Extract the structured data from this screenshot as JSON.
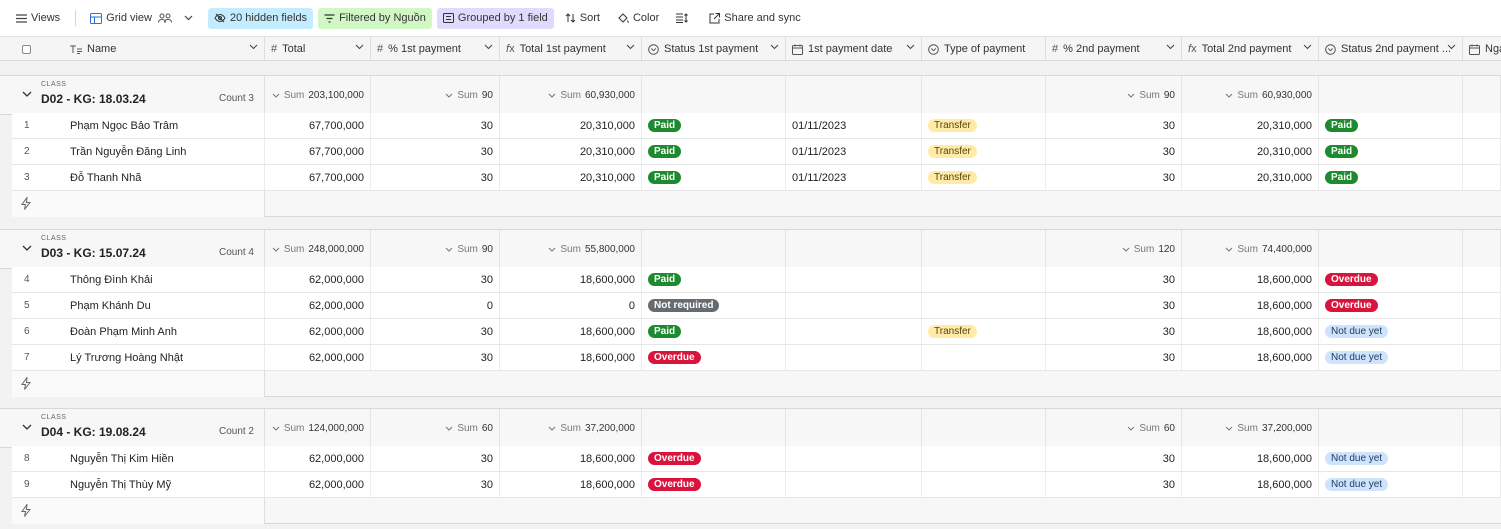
{
  "toolbar": {
    "views": "Views",
    "grid_view": "Grid view",
    "hidden_fields": "20 hidden fields",
    "filtered": "Filtered by Nguồn",
    "grouped": "Grouped by 1 field",
    "sort": "Sort",
    "color": "Color",
    "share": "Share and sync"
  },
  "columns": {
    "name": "Name",
    "total": "Total",
    "pct1": "% 1st payment",
    "total1": "Total 1st payment",
    "status1": "Status 1st payment",
    "date1": "1st payment date",
    "type": "Type of payment",
    "pct2": "% 2nd payment",
    "total2": "Total 2nd payment",
    "status2": "Status 2nd payment ...",
    "next": "Nga"
  },
  "sum_label": "Sum",
  "group_field_label": "CLASS",
  "groups": [
    {
      "title": "D02 - KG: 18.03.24",
      "count": "Count 3",
      "sums": {
        "total": "203,100,000",
        "pct1": "90",
        "total1": "60,930,000",
        "pct2": "90",
        "total2": "60,930,000"
      },
      "rows": [
        {
          "n": "1",
          "name": "Phạm Ngọc Bảo Trâm",
          "total": "67,700,000",
          "pct1": "30",
          "total1": "20,310,000",
          "status1": "Paid",
          "date1": "01/11/2023",
          "type": "Transfer",
          "pct2": "30",
          "total2": "20,310,000",
          "status2": "Paid"
        },
        {
          "n": "2",
          "name": "Trần Nguyễn Đăng Linh",
          "total": "67,700,000",
          "pct1": "30",
          "total1": "20,310,000",
          "status1": "Paid",
          "date1": "01/11/2023",
          "type": "Transfer",
          "pct2": "30",
          "total2": "20,310,000",
          "status2": "Paid"
        },
        {
          "n": "3",
          "name": "Đỗ Thanh Nhã",
          "total": "67,700,000",
          "pct1": "30",
          "total1": "20,310,000",
          "status1": "Paid",
          "date1": "01/11/2023",
          "type": "Transfer",
          "pct2": "30",
          "total2": "20,310,000",
          "status2": "Paid"
        }
      ]
    },
    {
      "title": "D03 - KG: 15.07.24",
      "count": "Count 4",
      "sums": {
        "total": "248,000,000",
        "pct1": "90",
        "total1": "55,800,000",
        "pct2": "120",
        "total2": "74,400,000"
      },
      "rows": [
        {
          "n": "4",
          "name": "Thông Đình Khải",
          "total": "62,000,000",
          "pct1": "30",
          "total1": "18,600,000",
          "status1": "Paid",
          "date1": "",
          "type": "",
          "pct2": "30",
          "total2": "18,600,000",
          "status2": "Overdue"
        },
        {
          "n": "5",
          "name": "Phạm Khánh Du",
          "total": "62,000,000",
          "pct1": "0",
          "total1": "0",
          "status1": "Not required",
          "date1": "",
          "type": "",
          "pct2": "30",
          "total2": "18,600,000",
          "status2": "Overdue"
        },
        {
          "n": "6",
          "name": "Đoàn Phạm Minh Anh",
          "total": "62,000,000",
          "pct1": "30",
          "total1": "18,600,000",
          "status1": "Paid",
          "date1": "",
          "type": "Transfer",
          "pct2": "30",
          "total2": "18,600,000",
          "status2": "Not due yet"
        },
        {
          "n": "7",
          "name": "Lý Trương Hoàng Nhật",
          "total": "62,000,000",
          "pct1": "30",
          "total1": "18,600,000",
          "status1": "Overdue",
          "date1": "",
          "type": "",
          "pct2": "30",
          "total2": "18,600,000",
          "status2": "Not due yet"
        }
      ]
    },
    {
      "title": "D04 - KG: 19.08.24",
      "count": "Count 2",
      "sums": {
        "total": "124,000,000",
        "pct1": "60",
        "total1": "37,200,000",
        "pct2": "60",
        "total2": "37,200,000"
      },
      "rows": [
        {
          "n": "8",
          "name": "Nguyễn Thị Kim Hiền",
          "total": "62,000,000",
          "pct1": "30",
          "total1": "18,600,000",
          "status1": "Overdue",
          "date1": "",
          "type": "",
          "pct2": "30",
          "total2": "18,600,000",
          "status2": "Not due yet"
        },
        {
          "n": "9",
          "name": "Nguyễn Thị Thùy Mỹ",
          "total": "62,000,000",
          "pct1": "30",
          "total1": "18,600,000",
          "status1": "Overdue",
          "date1": "",
          "type": "",
          "pct2": "30",
          "total2": "18,600,000",
          "status2": "Not due yet"
        }
      ]
    }
  ]
}
